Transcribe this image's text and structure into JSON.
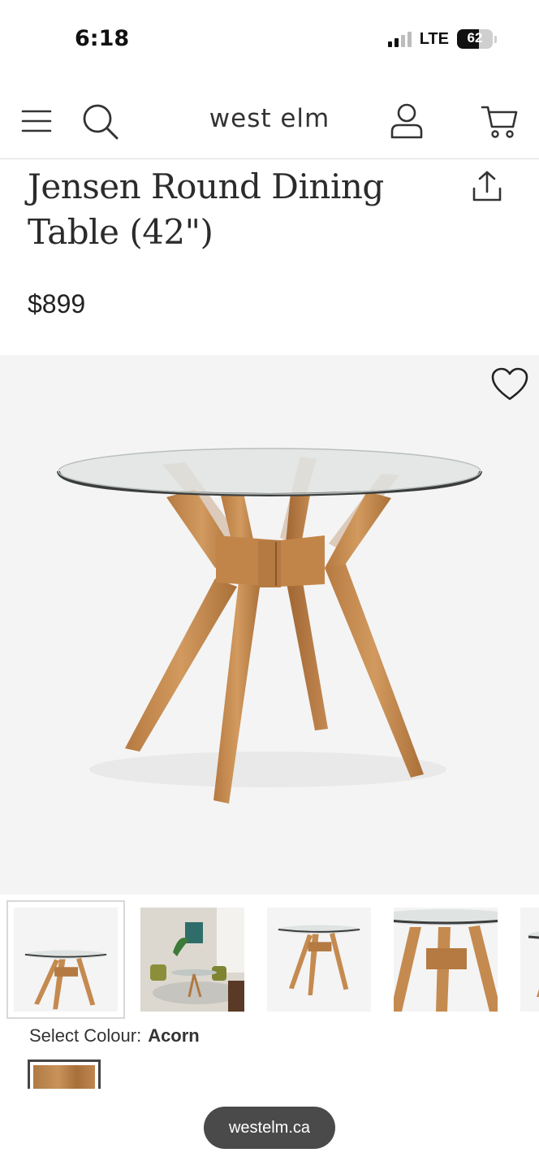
{
  "status_bar": {
    "time": "6:18",
    "network": "LTE",
    "battery": "62",
    "battery_level_percent": 62
  },
  "header": {
    "logo": "west elm",
    "icons": [
      "menu-icon",
      "search-icon",
      "account-icon",
      "cart-icon"
    ]
  },
  "product": {
    "title_line1": "Jensen Round Dining",
    "title_line2": "Table (42\")",
    "price": "$899"
  },
  "gallery": {
    "thumbnail_count": 5,
    "selected_index": 0
  },
  "colour": {
    "label": "Select Colour:",
    "value": "Acorn"
  },
  "browser": {
    "url": "westelm.ca"
  },
  "colors": {
    "wood": "#c58a4f",
    "glass": "#dfe3e1",
    "background_image": "#f4f4f4"
  }
}
